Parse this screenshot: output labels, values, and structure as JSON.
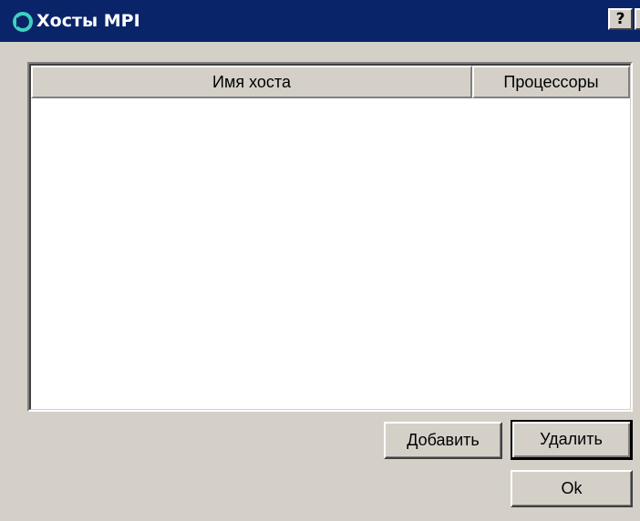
{
  "window": {
    "title": "Хосты MPI",
    "help_glyph": "?",
    "close_glyph": "✕",
    "icon": "app-swirl-icon",
    "accent": "#0a246a",
    "face": "#d4d0c8"
  },
  "hosts_table": {
    "columns": [
      "Имя хоста",
      "Процессоры"
    ],
    "rows": []
  },
  "buttons": {
    "add": "Добавить",
    "remove": "Удалить",
    "ok": "Ok"
  }
}
